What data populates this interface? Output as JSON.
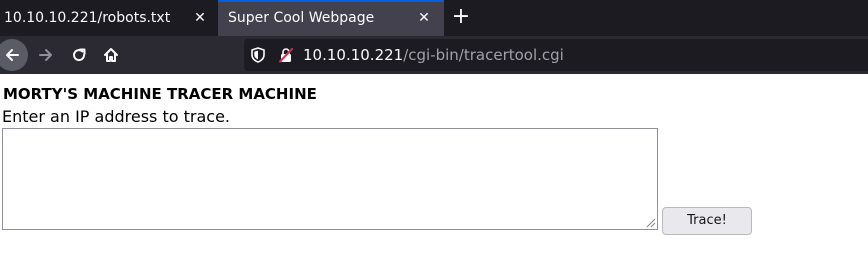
{
  "tabs": [
    {
      "title": "10.10.10.221/robots.txt",
      "active": false
    },
    {
      "title": "Super Cool Webpage",
      "active": true
    }
  ],
  "tab_close_glyph": "✕",
  "new_tab_glyph": "+",
  "toolbar": {
    "icons": [
      "back-arrow-icon",
      "forward-arrow-icon",
      "reload-icon",
      "home-icon"
    ]
  },
  "urlbar": {
    "host": "10.10.10.221",
    "path": "/cgi-bin/tracertool.cgi",
    "icons": [
      "shield-icon",
      "insecure-lock-icon"
    ]
  },
  "page": {
    "heading": "MORTY'S MACHINE TRACER MACHINE",
    "prompt": "Enter an IP address to trace.",
    "textarea_value": "",
    "button_label": "Trace!"
  },
  "colors": {
    "tabbar_bg": "#1c1b22",
    "active_tab_bg": "#42414d",
    "active_tab_accent": "#0060df",
    "navbar_bg": "#2b2a33",
    "urlbar_bg": "#1c1b22",
    "url_host": "#fbfbfe",
    "url_path": "#a0a0ab",
    "insecure_lock": "#e22850"
  }
}
